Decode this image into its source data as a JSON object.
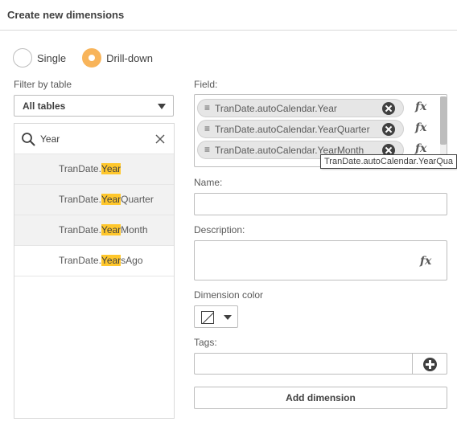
{
  "dialog": {
    "title": "Create new dimensions"
  },
  "mode": {
    "options": [
      {
        "label": "Single",
        "selected": false
      },
      {
        "label": "Drill-down",
        "selected": true
      }
    ],
    "accent_color": "#f8b45a"
  },
  "filter": {
    "label": "Filter by table",
    "selected": "All tables"
  },
  "search": {
    "value": "Year",
    "icon": "search-icon",
    "clear_icon": "close-icon"
  },
  "field_list": [
    {
      "prefix": "TranDate.",
      "match": "Year",
      "suffix": "",
      "selected": true
    },
    {
      "prefix": "TranDate.",
      "match": "Year",
      "suffix": "Quarter",
      "selected": true
    },
    {
      "prefix": "TranDate.",
      "match": "Year",
      "suffix": "Month",
      "selected": true
    },
    {
      "prefix": "TranDate.",
      "match": "Year",
      "suffix": "sAgo",
      "selected": false
    }
  ],
  "highlight_color": "#ffc72c",
  "field": {
    "label": "Field:",
    "chips": [
      {
        "text": "TranDate.autoCalendar.Year",
        "fx": "fx"
      },
      {
        "text": "TranDate.autoCalendar.YearQuarter",
        "fx": "fx"
      },
      {
        "text": "TranDate.autoCalendar.YearMonth",
        "fx": "fx"
      }
    ],
    "drag_glyph": "≡",
    "tooltip": "TranDate.autoCalendar.YearQua"
  },
  "name": {
    "label": "Name:",
    "value": ""
  },
  "description": {
    "label": "Description:",
    "value": "",
    "fx": "fx"
  },
  "color": {
    "label": "Dimension color"
  },
  "tags": {
    "label": "Tags:",
    "value": ""
  },
  "actions": {
    "add_label": "Add dimension"
  }
}
